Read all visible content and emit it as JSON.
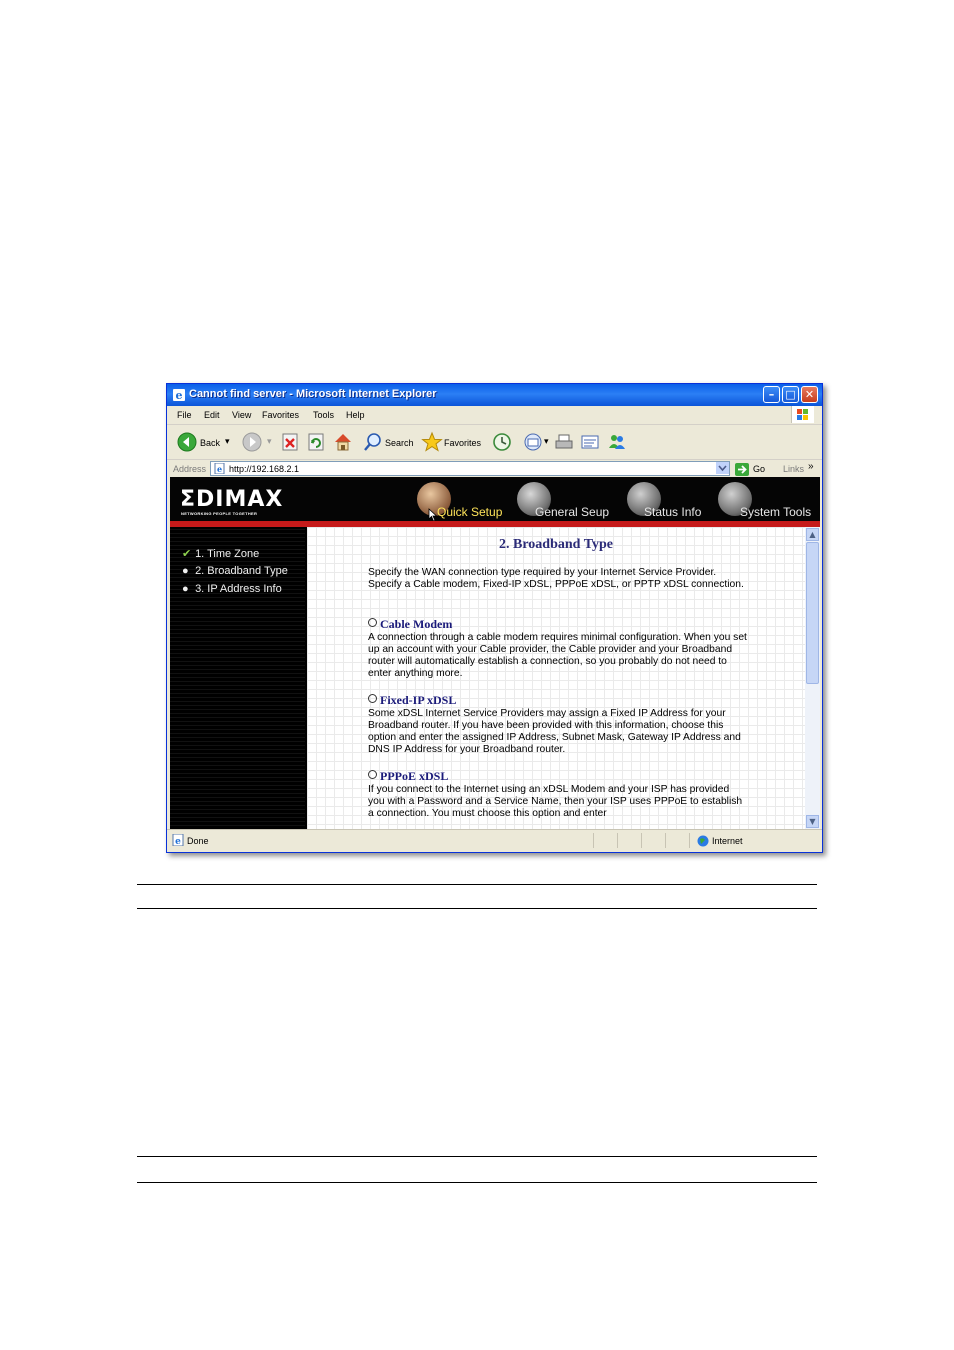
{
  "window": {
    "title": "Cannot find server - Microsoft Internet Explorer"
  },
  "menu": [
    "File",
    "Edit",
    "View",
    "Favorites",
    "Tools",
    "Help"
  ],
  "toolbar": {
    "back_label": "Back",
    "search_label": "Search",
    "favorites_label": "Favorites"
  },
  "address": {
    "label": "Address",
    "url": "http://192.168.2.1",
    "go_label": "Go",
    "links_label": "Links"
  },
  "brand": {
    "name": "ΣDIMAX",
    "tagline": "NETWORKING PEOPLE TOGETHER"
  },
  "nav": [
    "Quick Setup",
    "General Seup",
    "Status Info",
    "System Tools"
  ],
  "steps": [
    "1. Time Zone",
    "2. Broadband Type",
    "3. IP Address Info"
  ],
  "content": {
    "heading": "2. Broadband Type",
    "intro": "Specify the WAN connection type required by your Internet Service Provider. Specify a Cable modem, Fixed-IP xDSL, PPPoE xDSL, or PPTP xDSL connection.",
    "options": [
      {
        "title": "Cable Modem",
        "text": "A connection through a cable modem requires minimal configuration. When you set up an account with your Cable provider, the Cable provider and your Broadband router will automatically establish a connection, so you probably do not need to enter anything more."
      },
      {
        "title": "Fixed-IP xDSL",
        "text": "Some xDSL Internet Service Providers may assign a Fixed IP Address for your Broadband router. If you have been provided with this information, choose this option and enter the assigned IP Address, Subnet Mask, Gateway IP Address and DNS IP Address for your Broadband router."
      },
      {
        "title": "PPPoE xDSL",
        "text": "If you connect to the Internet using an xDSL Modem and your ISP has provided you with a Password and a Service Name, then your ISP uses PPPoE to establish a connection. You must choose this option and enter"
      }
    ]
  },
  "status": {
    "left": "Done",
    "zone": "Internet"
  },
  "icons": [
    "ie-icon",
    "back-icon",
    "forward-icon",
    "stop-icon",
    "refresh-icon",
    "home-icon",
    "search-icon",
    "favorites-icon",
    "history-icon",
    "mail-icon",
    "print-icon",
    "edit-icon",
    "messenger-icon",
    "page-icon",
    "go-icon",
    "globe-icon"
  ]
}
